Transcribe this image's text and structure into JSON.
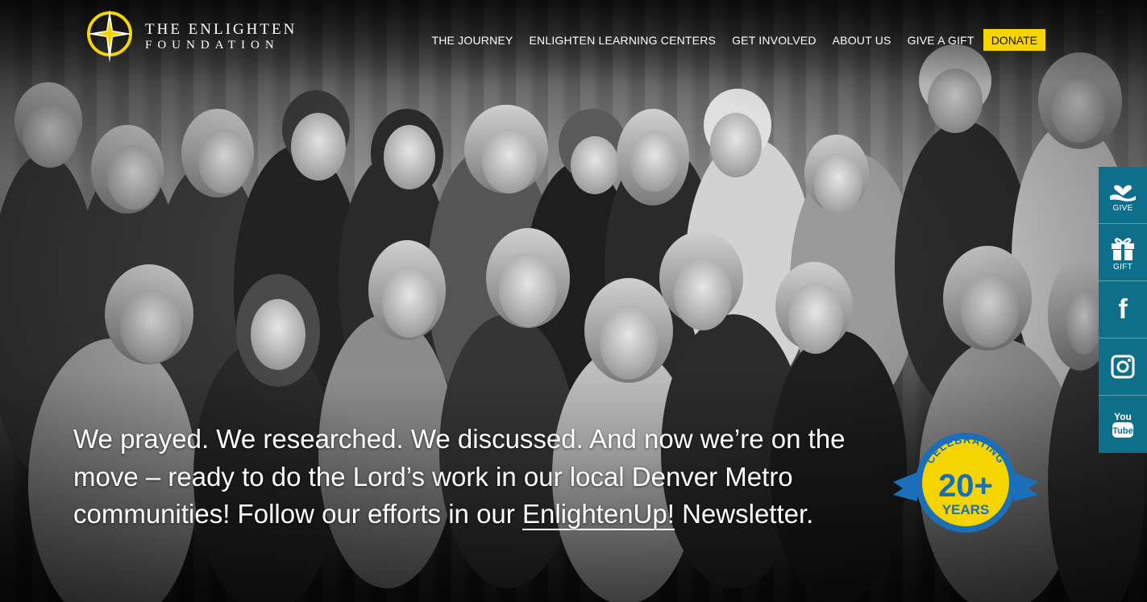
{
  "brand": {
    "line1": "THE ENLIGHTEN",
    "line2": "FOUNDATION",
    "gold": "#f5d400"
  },
  "nav": {
    "items": [
      "THE JOURNEY",
      "ENLIGHTEN LEARNING CENTERS",
      "GET INVOLVED",
      "ABOUT US",
      "GIVE A GIFT"
    ],
    "donate": "DONATE"
  },
  "sidebar": {
    "color": "#0e6f8a",
    "items": [
      {
        "label": "GIVE",
        "icon": "heart-hand-icon"
      },
      {
        "label": "GIFT",
        "icon": "gift-icon"
      },
      {
        "label": "",
        "icon": "facebook-icon"
      },
      {
        "label": "",
        "icon": "instagram-icon"
      },
      {
        "label": "",
        "icon": "youtube-icon"
      }
    ]
  },
  "hero": {
    "text_before": "We prayed. We researched. We discussed. And now we’re on the move – ready to do the Lord’s work in our local Denver Metro communities! Follow our efforts in our ",
    "link": "EnlightenUp!",
    "text_after": " Newsletter."
  },
  "badge": {
    "top": "CELEBRATING",
    "number": "20+",
    "bottom": "YEARS"
  }
}
